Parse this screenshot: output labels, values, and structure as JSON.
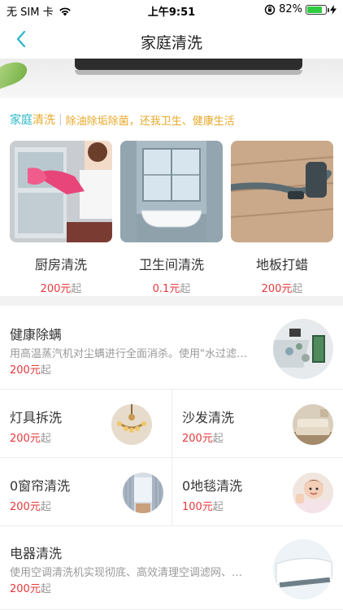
{
  "status": {
    "carrier": "无 SIM 卡",
    "time": "上午9:51",
    "battery": "82%",
    "battery_level": 0.82
  },
  "nav": {
    "title": "家庭清洗"
  },
  "section": {
    "title_a": "家庭",
    "title_b": "清洗",
    "subtitle": "除油除垢除菌，还我卫生、健康生活"
  },
  "categories": [
    {
      "name": "厨房清洗",
      "price": "200元",
      "suffix": "起"
    },
    {
      "name": "卫生间清洗",
      "price": "0.1元",
      "suffix": "起"
    },
    {
      "name": "地板打蜡",
      "price": "200元",
      "suffix": "起"
    }
  ],
  "services": {
    "mite": {
      "title": "健康除螨",
      "desc": "用高温蒸汽机对尘螨进行全面消杀。使用\"水过滤…",
      "price": "200元",
      "suffix": "起"
    },
    "lamp": {
      "title": "灯具拆洗",
      "price": "200元",
      "suffix": "起"
    },
    "sofa": {
      "title": "沙发清洗",
      "price": "200元",
      "suffix": "起"
    },
    "curtain": {
      "title": "0窗帘清洗",
      "price": "200元",
      "suffix": "起"
    },
    "carpet": {
      "title": "0地毯清洗",
      "price": "100元",
      "suffix": "起"
    },
    "appliance": {
      "title": "电器清洗",
      "desc": "使用空调清洗机实现彻底、高效清理空调滤网、…",
      "price": "200元",
      "suffix": "起"
    }
  }
}
